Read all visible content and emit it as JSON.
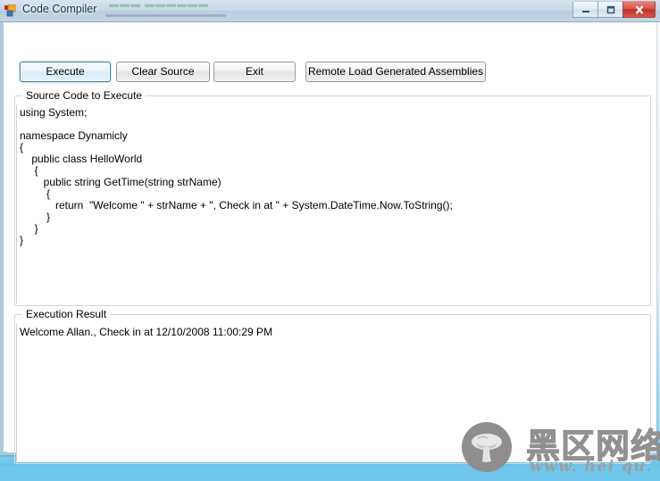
{
  "window": {
    "title": "Code Compiler",
    "icon_name": "visual-studio-project-icon",
    "controls": {
      "minimize_label": "–",
      "maximize_label": "□",
      "close_label": "✕"
    },
    "glass_ghost_top": "▬▬▬  ▬▬▬▬▬▬",
    "glass_ghost_bottom": "▬▬▬▬▬▬▬▬▬▬▬▬▬"
  },
  "toolbar": {
    "execute_label": "Execute",
    "clear_source_label": "Clear Source",
    "exit_label": "Exit",
    "remote_load_label": "Remote Load Generated Assemblies"
  },
  "source_group": {
    "title": "Source Code to Execute",
    "lines": [
      "using System;",
      "",
      "namespace Dynamicly",
      "{",
      "    public class HelloWorld",
      "     {",
      "        public string GetTime(string strName)",
      "         {",
      "            return  \"Welcome \" + strName + \", Check in at \" + System.DateTime.Now.ToString();",
      "         }",
      "     }",
      "}"
    ]
  },
  "result_group": {
    "title": "Execution Result",
    "lines": [
      "Welcome Allan., Check in at 12/10/2008 11:00:29 PM"
    ]
  },
  "watermark": {
    "chinese_text": "黑区网络",
    "url_text": "www. hei qu. com",
    "logo_name": "mushroom-logo"
  },
  "colors": {
    "accent_blue": "#3c7fb1",
    "close_red": "#d9544a",
    "titlebar_glass": "#c6d6e5",
    "groupbox_border": "#d5d5d5",
    "desktop_blue": "#62c3e8"
  }
}
